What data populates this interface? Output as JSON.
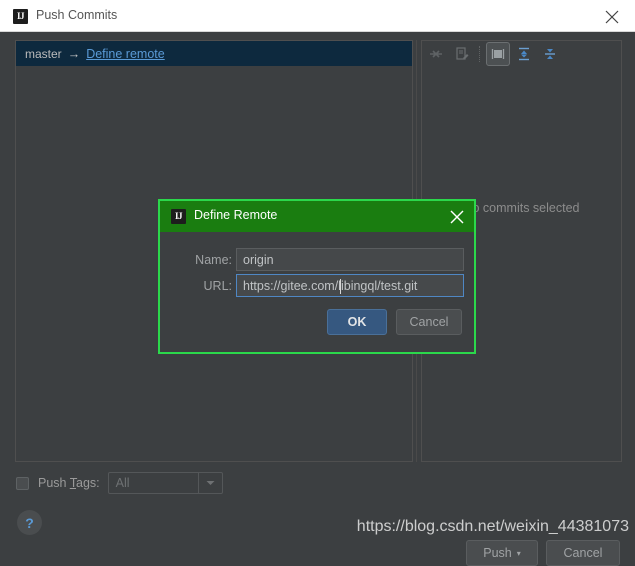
{
  "window": {
    "title": "Push Commits",
    "logo_icon": "intellij-idea-logo",
    "close_icon": "close-icon"
  },
  "left_panel": {
    "branch_row": {
      "branch": "master",
      "arrow": "→",
      "link_label": "Define remote"
    }
  },
  "toolbar": {
    "buttons": [
      {
        "name": "collapse-arrows-icon",
        "label": "",
        "enabled": false
      },
      {
        "name": "edit-commit-message-icon",
        "label": "",
        "enabled": false
      },
      {
        "name": "show-diff-icon",
        "label": "",
        "enabled": true,
        "selected": true
      },
      {
        "name": "expand-all-icon",
        "label": "",
        "enabled": true
      },
      {
        "name": "collapse-all-icon",
        "label": "",
        "enabled": true
      }
    ]
  },
  "right_panel": {
    "empty_message": "No commits selected"
  },
  "push_tags": {
    "label_prefix": "Push ",
    "label_mnemonic": "T",
    "label_suffix": "ags:",
    "checked": false,
    "combo_value": "All",
    "combo_enabled": false,
    "chevron_icon": "chevron-down-icon"
  },
  "footer": {
    "help_icon": "question-mark-icon",
    "help_label": "?",
    "push_label": "Push",
    "push_arrow": "▾",
    "cancel_label": "Cancel"
  },
  "watermark": {
    "text": "https://blog.csdn.net/weixin_44381073"
  },
  "modal": {
    "title": "Define Remote",
    "logo_icon": "intellij-idea-logo",
    "close_icon": "close-icon",
    "name_label": "Name:",
    "name_value": "origin",
    "url_label": "URL:",
    "url_value": "https://gitee.com/libingql/test.git",
    "ok_label": "OK",
    "cancel_label": "Cancel",
    "border_color": "#2bd84b",
    "titlebar_color": "#1a7d10"
  }
}
